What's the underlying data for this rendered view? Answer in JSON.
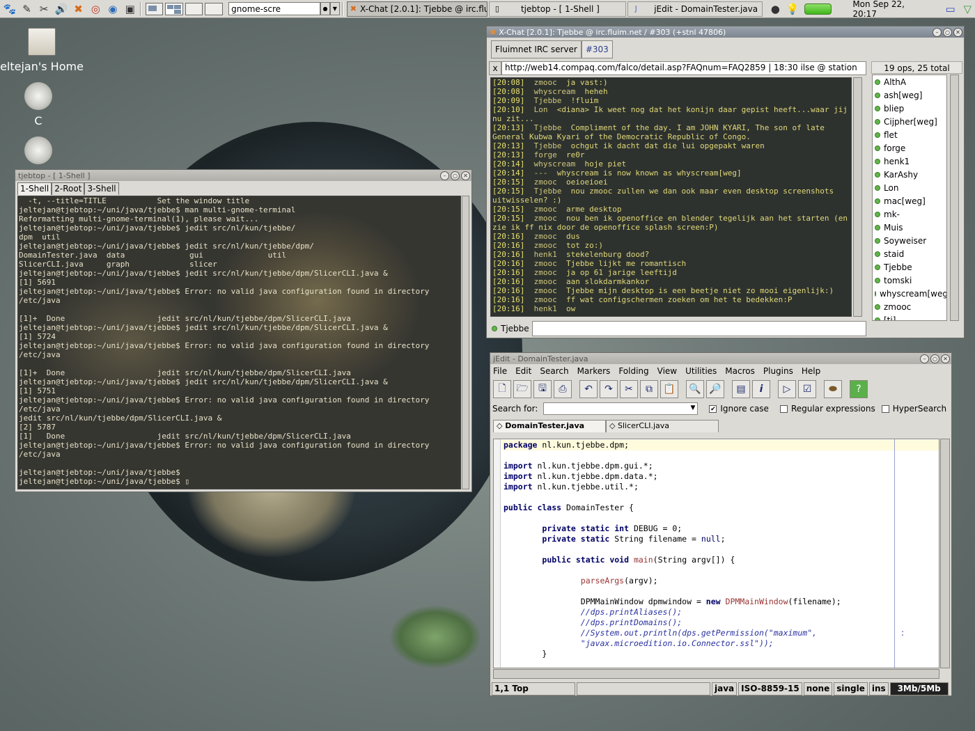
{
  "panel": {
    "command_entry": "gnome-scre",
    "tasks": [
      {
        "label": "X-Chat [2.0.1]: Tjebbe @ irc.flui",
        "icon": "x-chat-icon"
      },
      {
        "label": "tjebtop - [ 1-Shell ]",
        "icon": "terminal-icon"
      },
      {
        "label": "jEdit - DomainTester.java",
        "icon": "jedit-icon"
      }
    ],
    "clock": "Mon Sep 22, 20:17"
  },
  "desktop": {
    "icons": [
      "eltejan's Home",
      "C"
    ]
  },
  "terminal": {
    "title": "tjebtop - [ 1-Shell ]",
    "tabs": [
      "1-Shell",
      "2-Root",
      "3-Shell"
    ],
    "lines": [
      "  -t, --title=TITLE           Set the window title",
      "jeltejan@tjebtop:~/uni/java/tjebbe$ man multi-gnome-terminal",
      "Reformatting multi-gnome-terminal(1), please wait...",
      "jeltejan@tjebtop:~/uni/java/tjebbe$ jedit src/nl/kun/tjebbe/",
      "dpm  util",
      "jeltejan@tjebtop:~/uni/java/tjebbe$ jedit src/nl/kun/tjebbe/dpm/",
      "DomainTester.java  data              gui              util",
      "SlicerCLI.java     graph             slicer",
      "jeltejan@tjebtop:~/uni/java/tjebbe$ jedit src/nl/kun/tjebbe/dpm/SlicerCLI.java &",
      "[1] 5691",
      "jeltejan@tjebtop:~/uni/java/tjebbe$ Error: no valid java configuration found in directory",
      "/etc/java",
      "",
      "[1]+  Done                    jedit src/nl/kun/tjebbe/dpm/SlicerCLI.java",
      "jeltejan@tjebtop:~/uni/java/tjebbe$ jedit src/nl/kun/tjebbe/dpm/SlicerCLI.java &",
      "[1] 5724",
      "jeltejan@tjebtop:~/uni/java/tjebbe$ Error: no valid java configuration found in directory",
      "/etc/java",
      "",
      "[1]+  Done                    jedit src/nl/kun/tjebbe/dpm/SlicerCLI.java",
      "jeltejan@tjebtop:~/uni/java/tjebbe$ jedit src/nl/kun/tjebbe/dpm/SlicerCLI.java &",
      "[1] 5751",
      "jeltejan@tjebtop:~/uni/java/tjebbe$ Error: no valid java configuration found in directory",
      "/etc/java",
      "jedit src/nl/kun/tjebbe/dpm/SlicerCLI.java &",
      "[2] 5787",
      "[1]   Done                    jedit src/nl/kun/tjebbe/dpm/SlicerCLI.java",
      "jeltejan@tjebtop:~/uni/java/tjebbe$ Error: no valid java configuration found in directory",
      "/etc/java",
      "",
      "jeltejan@tjebtop:~/uni/java/tjebbe$",
      "jeltejan@tjebtop:~/uni/java/tjebbe$ ▯"
    ]
  },
  "xchat": {
    "title": "X-Chat [2.0.1]: Tjebbe @ irc.fluim.net / #303 (+stnl 47806)",
    "tabs": [
      "Fluimnet IRC server",
      "#303"
    ],
    "topic_close": "x",
    "topic": "http://web14.compaq.com/falco/detail.asp?FAQnum=FAQ2859 | 18:30 ilse @ station",
    "ops": "19 ops, 25 total",
    "messages": [
      {
        "ts": "[20:08]",
        "nick": "zmooc",
        "text": "ja vast:)"
      },
      {
        "ts": "[20:08]",
        "nick": "whyscream",
        "text": "heheh"
      },
      {
        "ts": "[20:09]",
        "nick": "Tjebbe",
        "text": "!fluim"
      },
      {
        "ts": "[20:10]",
        "nick": "Lon",
        "text": "<diana> Ik weet nog dat het konijn daar gepist heeft...waar jij nu zit..."
      },
      {
        "ts": "[20:13]",
        "nick": "Tjebbe",
        "text": "Compliment of the day. I am JOHN KYARI, The son of late General Kubwa Kyari of the Democratic Republic of Congo."
      },
      {
        "ts": "[20:13]",
        "nick": "Tjebbe",
        "text": "ochgut ik dacht dat die lui opgepakt waren"
      },
      {
        "ts": "[20:13]",
        "nick": "forge",
        "text": "re0r"
      },
      {
        "ts": "[20:14]",
        "nick": "whyscream",
        "text": "hoje piet"
      },
      {
        "ts": "[20:14]",
        "nick": "---",
        "text": "whyscream is now known as whyscream[weg]"
      },
      {
        "ts": "[20:15]",
        "nick": "zmooc",
        "text": "oeioeioei"
      },
      {
        "ts": "[20:15]",
        "nick": "Tjebbe",
        "text": "nou zmooc zullen we dan ook maar even desktop screenshots uitwisselen? :)"
      },
      {
        "ts": "[20:15]",
        "nick": "zmooc",
        "text": "arme desktop"
      },
      {
        "ts": "[20:15]",
        "nick": "zmooc",
        "text": "nou ben ik openoffice en blender tegelijk aan het starten (en zie ik ff nix door de openoffice splash screen:P)"
      },
      {
        "ts": "[20:16]",
        "nick": "zmooc",
        "text": "dus"
      },
      {
        "ts": "[20:16]",
        "nick": "zmooc",
        "text": "tot zo:)"
      },
      {
        "ts": "[20:16]",
        "nick": "henk1",
        "text": "stekelenburg dood?"
      },
      {
        "ts": "[20:16]",
        "nick": "zmooc",
        "text": "Tjebbe lijkt me romantisch"
      },
      {
        "ts": "[20:16]",
        "nick": "zmooc",
        "text": "ja op 61 jarige leeftijd"
      },
      {
        "ts": "[20:16]",
        "nick": "zmooc",
        "text": "aan slokdarmkankor"
      },
      {
        "ts": "[20:16]",
        "nick": "zmooc",
        "text": "Tjebbe mijn desktop is een beetje niet zo mooi eigenlijk:)"
      },
      {
        "ts": "[20:16]",
        "nick": "zmooc",
        "text": "ff wat configschermen zoeken om het te bedekken:P"
      },
      {
        "ts": "[20:16]",
        "nick": "henk1",
        "text": "ow"
      }
    ],
    "users": [
      "AlthA",
      "ash[weg]",
      "bliep",
      "Cijpher[weg]",
      "flet",
      "forge",
      "henk1",
      "KarAshy",
      "Lon",
      "mac[weg]",
      "mk-",
      "Muis",
      "Soyweiser",
      "staid",
      "Tjebbe",
      "tomski",
      "whyscream[weg]",
      "zmooc",
      "[ti]"
    ],
    "input_nick": "Tjebbe"
  },
  "jedit": {
    "title": "jEdit - DomainTester.java",
    "menu": [
      "File",
      "Edit",
      "Search",
      "Markers",
      "Folding",
      "View",
      "Utilities",
      "Macros",
      "Plugins",
      "Help"
    ],
    "search_label": "Search for:",
    "options": [
      "Ignore case",
      "Regular expressions",
      "HyperSearch"
    ],
    "buffers": [
      "DomainTester.java",
      "SlicerCLI.java"
    ],
    "status": [
      "1,1 Top",
      "java",
      "ISO-8859-15",
      "none",
      "single",
      "ins",
      "3Mb/5Mb"
    ],
    "code_marker": ":"
  }
}
